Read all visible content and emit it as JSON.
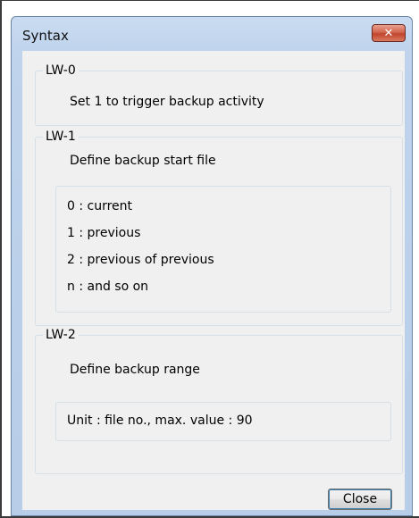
{
  "window": {
    "title": "Syntax",
    "close_glyph": "✕"
  },
  "groups": [
    {
      "label": "LW-0",
      "description": "Set 1 to trigger backup activity"
    },
    {
      "label": "LW-1",
      "description": "Define backup start file",
      "options": [
        "0 : current",
        "1 : previous",
        "2 : previous of previous",
        "n : and so on"
      ]
    },
    {
      "label": "LW-2",
      "description": "Define backup range",
      "note": "Unit : file no., max. value : 90"
    }
  ],
  "buttons": {
    "close_label": "Close"
  },
  "colors": {
    "title_bar": "#bfd3ec",
    "client_bg": "#f0f0f0",
    "close_button_red": "#c2452d",
    "group_border": "#d5dfe5"
  }
}
